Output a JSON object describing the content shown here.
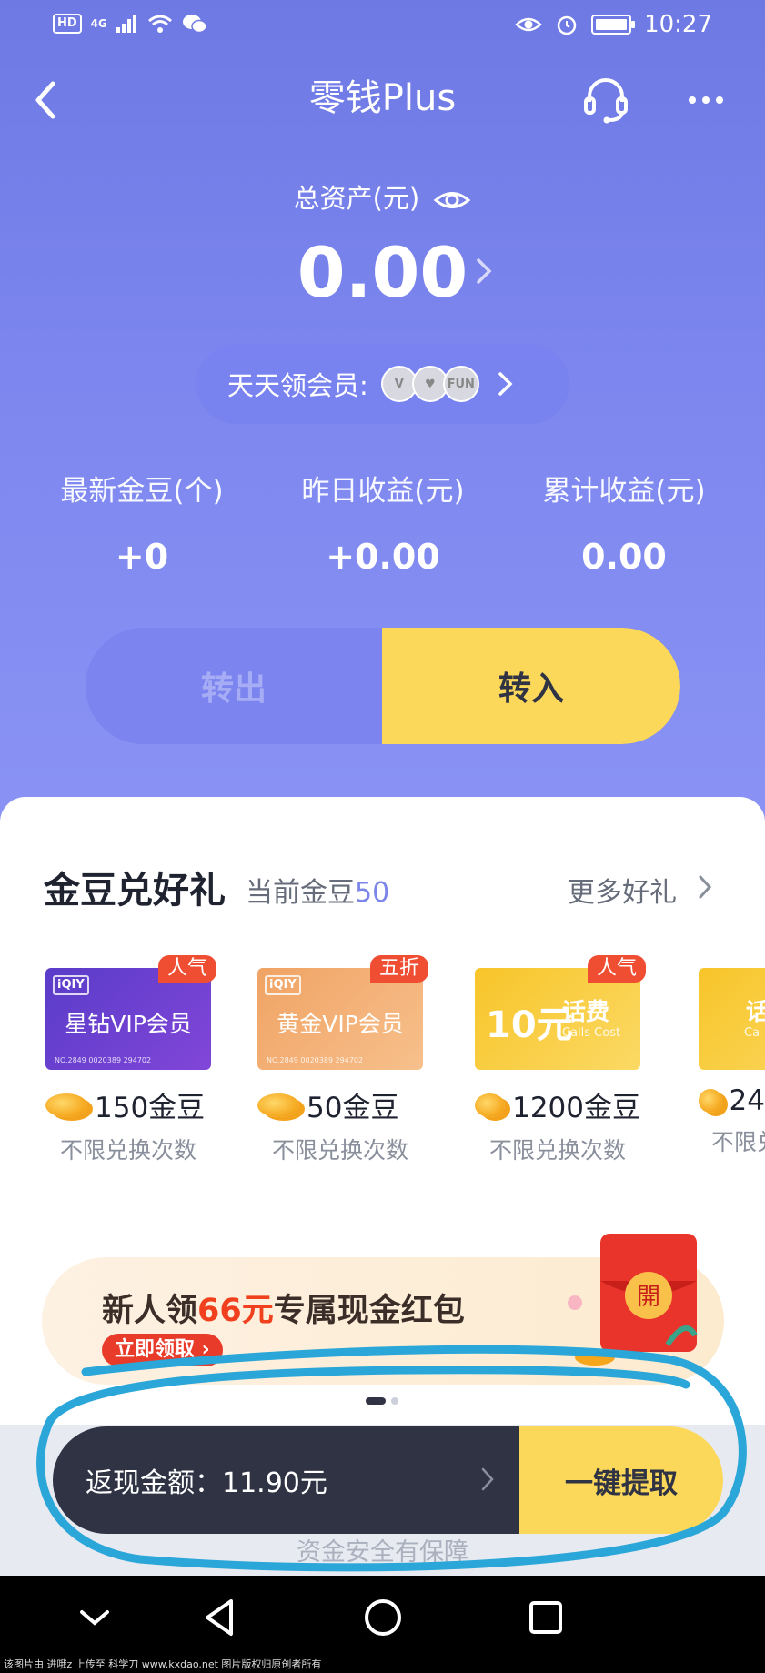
{
  "status_bar": {
    "network_badge": "HD",
    "signal": "4G",
    "time": "10:27"
  },
  "nav": {
    "title": "零钱Plus"
  },
  "assets": {
    "label": "总资产(元)",
    "value": "0.00"
  },
  "member": {
    "label": "天天领会员:",
    "badges": [
      "V",
      "♥",
      "FUN"
    ]
  },
  "stats": [
    {
      "label": "最新金豆(个)",
      "value": "+0"
    },
    {
      "label": "昨日收益(元)",
      "value": "+0.00"
    },
    {
      "label": "累计收益(元)",
      "value": "0.00"
    }
  ],
  "transfer": {
    "out_label": "转出",
    "in_label": "转入"
  },
  "gifts_section": {
    "title": "金豆兑好礼",
    "current_label": "当前金豆",
    "current_value": "50",
    "more_label": "更多好礼",
    "items": [
      {
        "logo": "iQIY",
        "name": "星钻VIP会员",
        "serial": "NO.2849 0020389 294702",
        "tag": "人气",
        "price": "150金豆",
        "note": "不限兑换次数",
        "color_from": "#5a3cc9",
        "color_to": "#8146d8"
      },
      {
        "logo": "iQIY",
        "name": "黄金VIP会员",
        "serial": "NO.2849 0020389 294702",
        "tag": "五折",
        "price": "50金豆",
        "note": "不限兑换次数",
        "color_from": "#f0a364",
        "color_to": "#f7c08c"
      },
      {
        "logo": "10元",
        "name": "话费",
        "serial": "Calls Cost",
        "tag": "人气",
        "price": "1200金豆",
        "note": "不限兑换次数",
        "color_from": "#f8c52a",
        "color_to": "#fbd964"
      },
      {
        "logo": "",
        "name": "话",
        "serial": "Ca",
        "tag": "",
        "price": "24",
        "note": "不限兑",
        "color_from": "#f8c52a",
        "color_to": "#fbd964"
      }
    ]
  },
  "banner": {
    "title_pre": "新人领",
    "title_highlight": "66元",
    "title_post": "专属现金红包",
    "cta": "立即领取 ›",
    "envelope_text": "開"
  },
  "bottom_bar": {
    "cash_label": "返现金额：11.90元",
    "withdraw_label": "一键提取",
    "safety_note": "资金安全有保障"
  },
  "footer": {
    "text": "该图片由 进哦z 上传至 科学刀 www.kxdao.net 图片版权归原创者所有"
  }
}
